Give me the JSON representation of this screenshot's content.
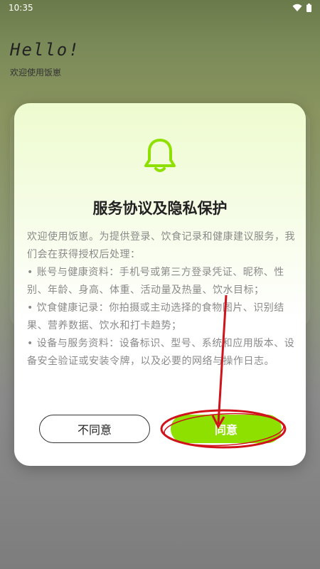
{
  "status_bar": {
    "time": "10:35"
  },
  "background": {
    "hello": "Hello!",
    "welcome": "欢迎使用饭崽"
  },
  "dialog": {
    "icon": "bell-icon",
    "title": "服务协议及隐私保护",
    "paragraphs": [
      "欢迎使用饭崽。为提供登录、饮食记录和健康建议服务，我们会在获得授权后处理：",
      "• 账号与健康资料：手机号或第三方登录凭证、昵称、性别、年龄、身高、体重、活动量及热量、饮水目标；",
      "• 饮食健康记录：你拍摄或主动选择的食物图片、识别结果、营养数据、饮水和打卡趋势；",
      "• 设备与服务资料：设备标识、型号、系统和应用版本、设备安全验证或安装令牌，以及必要的网络与操作日志。"
    ],
    "disagree_label": "不同意",
    "agree_label": "同意"
  },
  "colors": {
    "accent": "#8ee000",
    "annotation": "#d0121b"
  }
}
